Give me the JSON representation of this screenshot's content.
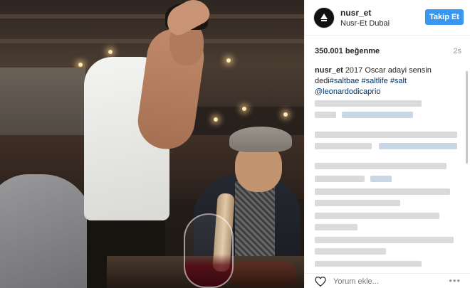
{
  "post": {
    "author": {
      "username": "nusr_et",
      "location": "Nusr-Et Dubai"
    },
    "follow_label": "Takip Et",
    "likes_text": "350.001 beğenme",
    "time_ago": "2s",
    "caption": {
      "username": "nusr_et",
      "text_1": "2017 Oscar adayi sensin",
      "text_2": "dedi",
      "tags": [
        "#saltbae",
        "#saltlife",
        "#salt"
      ],
      "mention": "@leonardodicaprio"
    },
    "comment_placeholder": "Yorum ekle...",
    "more_label": "•••"
  },
  "colors": {
    "follow_button": "#3897f0",
    "link": "#003569",
    "muted": "#999999"
  },
  "icons": [
    "avatar-logo-icon",
    "heart-icon",
    "more-options-icon"
  ]
}
